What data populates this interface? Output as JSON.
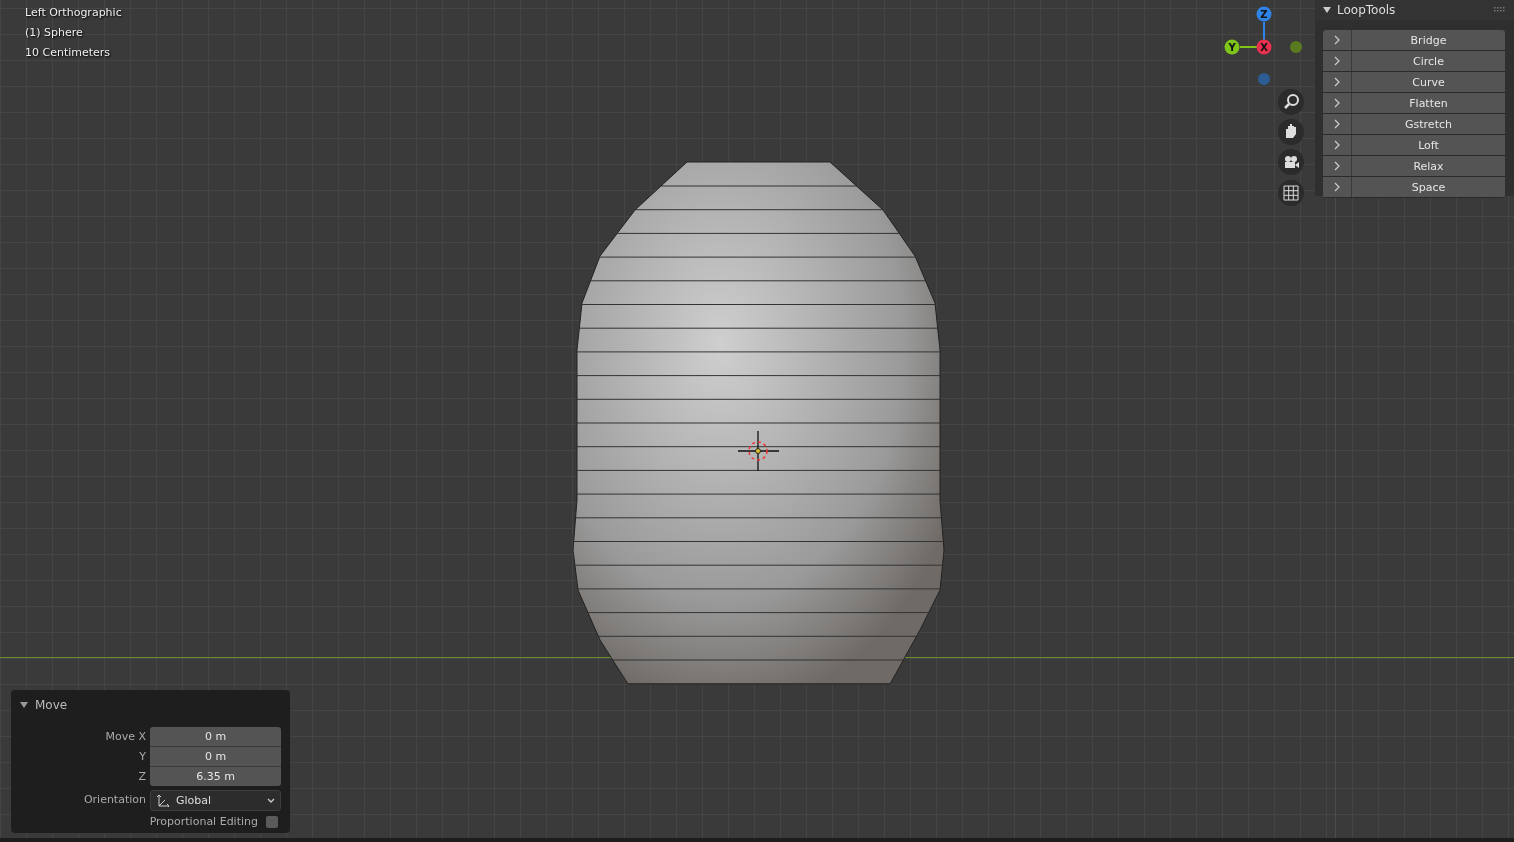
{
  "viewport": {
    "info_lines": [
      "Left Orthographic",
      "(1) Sphere",
      "10 Centimeters"
    ]
  },
  "gizmo": {
    "axes": [
      {
        "label": "Z",
        "kind": "z"
      },
      {
        "label": "Y",
        "kind": "y"
      },
      {
        "label": "X",
        "kind": "x"
      }
    ]
  },
  "looptools": {
    "title": "LoopTools",
    "expanded": true,
    "buttons": [
      {
        "label": "Bridge",
        "expanded": false
      },
      {
        "label": "Circle",
        "expanded": false
      },
      {
        "label": "Curve",
        "expanded": false
      },
      {
        "label": "Flatten",
        "expanded": false
      },
      {
        "label": "Gstretch",
        "expanded": false
      },
      {
        "label": "Loft",
        "expanded": false
      },
      {
        "label": "Relax",
        "expanded": false
      },
      {
        "label": "Space",
        "expanded": false
      }
    ]
  },
  "move_panel": {
    "title": "Move",
    "expanded": true,
    "fields": [
      {
        "label": "Move X",
        "value": "0 m"
      },
      {
        "label": "Y",
        "value": "0 m"
      },
      {
        "label": "Z",
        "value": "6.35 m"
      }
    ],
    "orientation": {
      "label": "Orientation",
      "value": "Global"
    },
    "proportional_editing": {
      "label": "Proportional Editing",
      "checked": false
    }
  }
}
